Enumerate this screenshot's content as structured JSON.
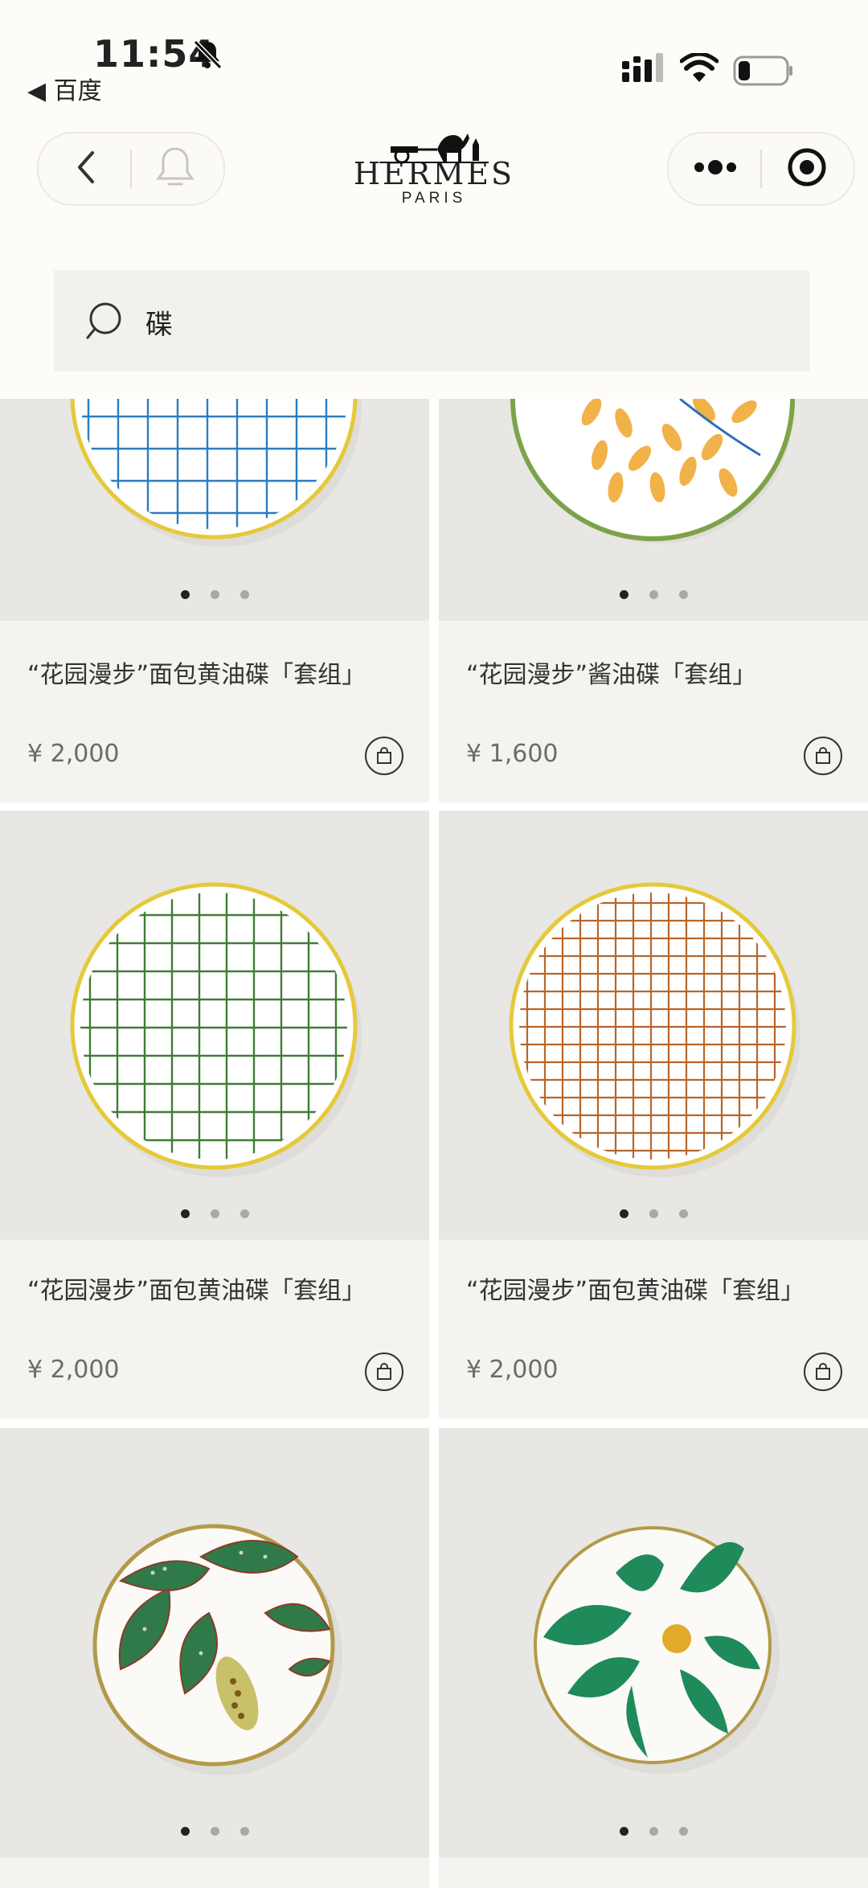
{
  "status_bar": {
    "time": "11:54",
    "back_app": "◀ 百度"
  },
  "header": {
    "brand": "HERMÈS",
    "city": "PARIS"
  },
  "search": {
    "query": "碟"
  },
  "products": [
    {
      "title": "“花园漫步”面包黄油碟「套组」",
      "price": "¥ 2,000",
      "image": "blue-grid-plate"
    },
    {
      "title": "“花园漫步”酱油碟「套组」",
      "price": "¥ 1,600",
      "image": "orange-leaf-dish"
    },
    {
      "title": "“花园漫步”面包黄油碟「套组」",
      "price": "¥ 2,000",
      "image": "green-grid-plate"
    },
    {
      "title": "“花园漫步”面包黄油碟「套组」",
      "price": "¥ 2,000",
      "image": "orange-grid-plate"
    },
    {
      "title": "",
      "price": "",
      "image": "begonia-leaf-plate"
    },
    {
      "title": "",
      "price": "",
      "image": "green-leaf-fruit-plate"
    }
  ],
  "carousel": {
    "count": 3,
    "active": 1
  },
  "colors": {
    "background": "#fdfcf8",
    "card": "#f5f3ef",
    "image_bg": "#e8e7e3"
  }
}
